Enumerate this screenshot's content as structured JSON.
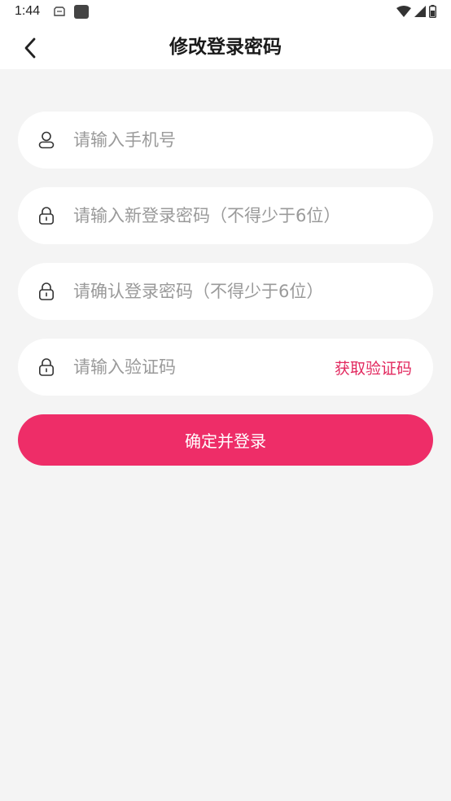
{
  "status_bar": {
    "time": "1:44"
  },
  "header": {
    "title": "修改登录密码"
  },
  "form": {
    "phone": {
      "placeholder": "请输入手机号",
      "value": ""
    },
    "new_password": {
      "placeholder": "请输入新登录密码（不得少于6位）",
      "value": ""
    },
    "confirm_password": {
      "placeholder": "请确认登录密码（不得少于6位）",
      "value": ""
    },
    "verify_code": {
      "placeholder": "请输入验证码",
      "value": "",
      "get_code_label": "获取验证码"
    },
    "submit_label": "确定并登录"
  },
  "colors": {
    "accent": "#ee2d68",
    "link": "#e2295f",
    "background": "#f4f4f4"
  },
  "icons": {
    "back": "chevron-left-icon",
    "user": "user-icon",
    "lock": "lock-icon"
  }
}
